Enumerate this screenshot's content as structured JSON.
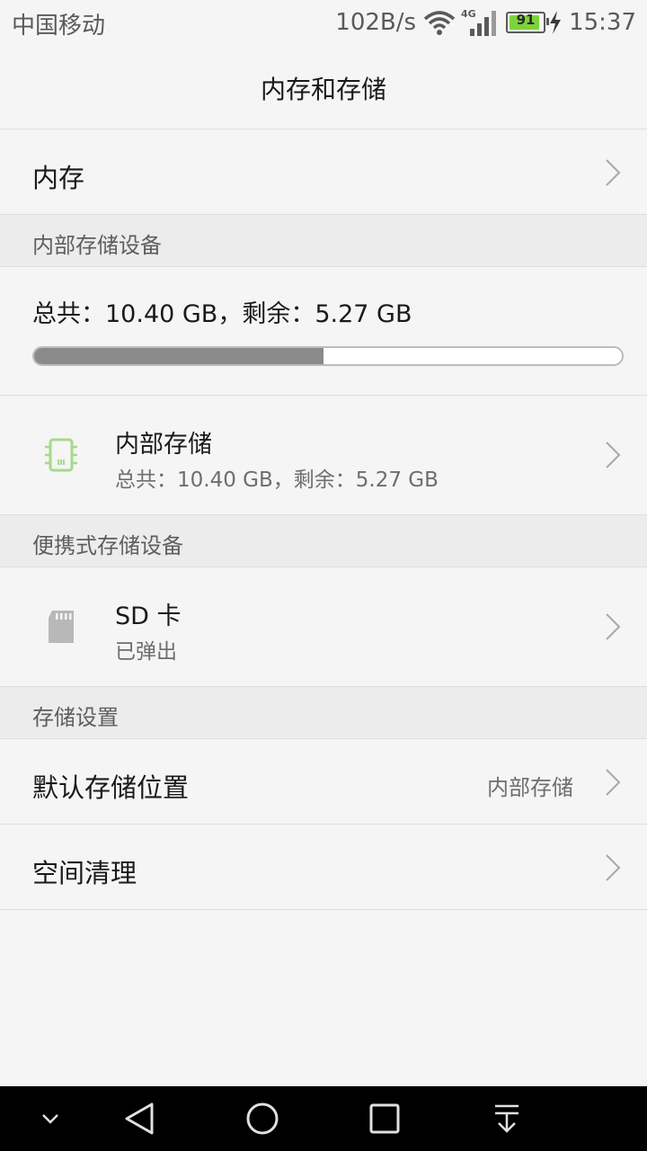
{
  "status_bar": {
    "carrier": "中国移动",
    "net_speed": "102B/s",
    "network_type": "4G",
    "battery_level": "91",
    "battery_fraction": 0.91,
    "time": "15:37"
  },
  "header": {
    "title": "内存和存储"
  },
  "memory_row": {
    "label": "内存"
  },
  "internal_section": {
    "header": "内部存储设备",
    "summary": "总共：10.40 GB，剩余：5.27 GB",
    "used_fraction": 0.493,
    "item": {
      "name": "内部存储",
      "detail": "总共：10.40 GB，剩余：5.27 GB",
      "icon": "chip-icon"
    }
  },
  "portable_section": {
    "header": "便携式存储设备",
    "item": {
      "name": "SD 卡",
      "detail": "已弹出",
      "icon": "sd-card-icon"
    }
  },
  "settings_section": {
    "header": "存储设置",
    "default_location": {
      "label": "默认存储位置",
      "value": "内部存储"
    },
    "cleanup": {
      "label": "空间清理"
    }
  },
  "nav_bar": {
    "buttons": [
      "collapse-icon",
      "back-icon",
      "home-icon",
      "recents-icon",
      "notification-pull-icon"
    ]
  },
  "colors": {
    "accent_chip": "#a6d98a",
    "progress_used": "#8a8a8a",
    "battery_fill": "#7cd33b"
  }
}
